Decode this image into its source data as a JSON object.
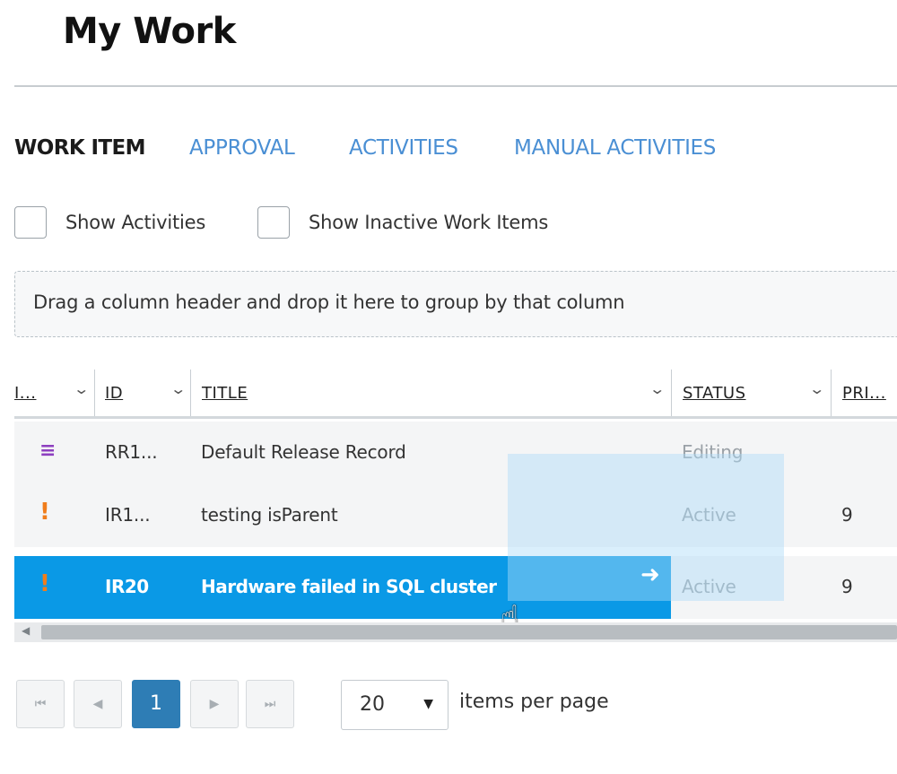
{
  "page": {
    "title": "My Work"
  },
  "tabs": [
    {
      "label": "WORK ITEM",
      "active": true
    },
    {
      "label": "APPROVAL",
      "active": false
    },
    {
      "label": "ACTIVITIES",
      "active": false
    },
    {
      "label": "MANUAL ACTIVITIES",
      "active": false
    }
  ],
  "filters": {
    "show_activities": {
      "label": "Show Activities",
      "checked": false
    },
    "show_inactive": {
      "label": "Show Inactive Work Items",
      "checked": false
    }
  },
  "group_panel": {
    "text": "Drag a column header and drop it here to group by that column"
  },
  "columns": [
    {
      "label": "I..."
    },
    {
      "label": "ID"
    },
    {
      "label": "TITLE"
    },
    {
      "label": "STATUS"
    },
    {
      "label": "PRI..."
    }
  ],
  "rows": [
    {
      "icon": "checklist-icon",
      "id": "RR1...",
      "title": "Default Release Record",
      "status": "Editing",
      "priority": "",
      "selected": false
    },
    {
      "icon": "exclamation-icon",
      "id": "IR1...",
      "title": "testing isParent",
      "status": "Active",
      "priority": "9",
      "selected": false
    },
    {
      "icon": "exclamation-icon",
      "id": "IR20",
      "title": "Hardware failed in SQL cluster",
      "status": "Active",
      "priority": "9",
      "selected": true
    }
  ],
  "pager": {
    "current_page": "1",
    "page_size": "20",
    "page_size_label": "items per page"
  },
  "colors": {
    "accent": "#4a8fd4",
    "selected_row": "#0a99e6",
    "current_page": "#2e7db5",
    "incident_icon": "#f07d1b",
    "release_icon": "#8d3fbf"
  }
}
